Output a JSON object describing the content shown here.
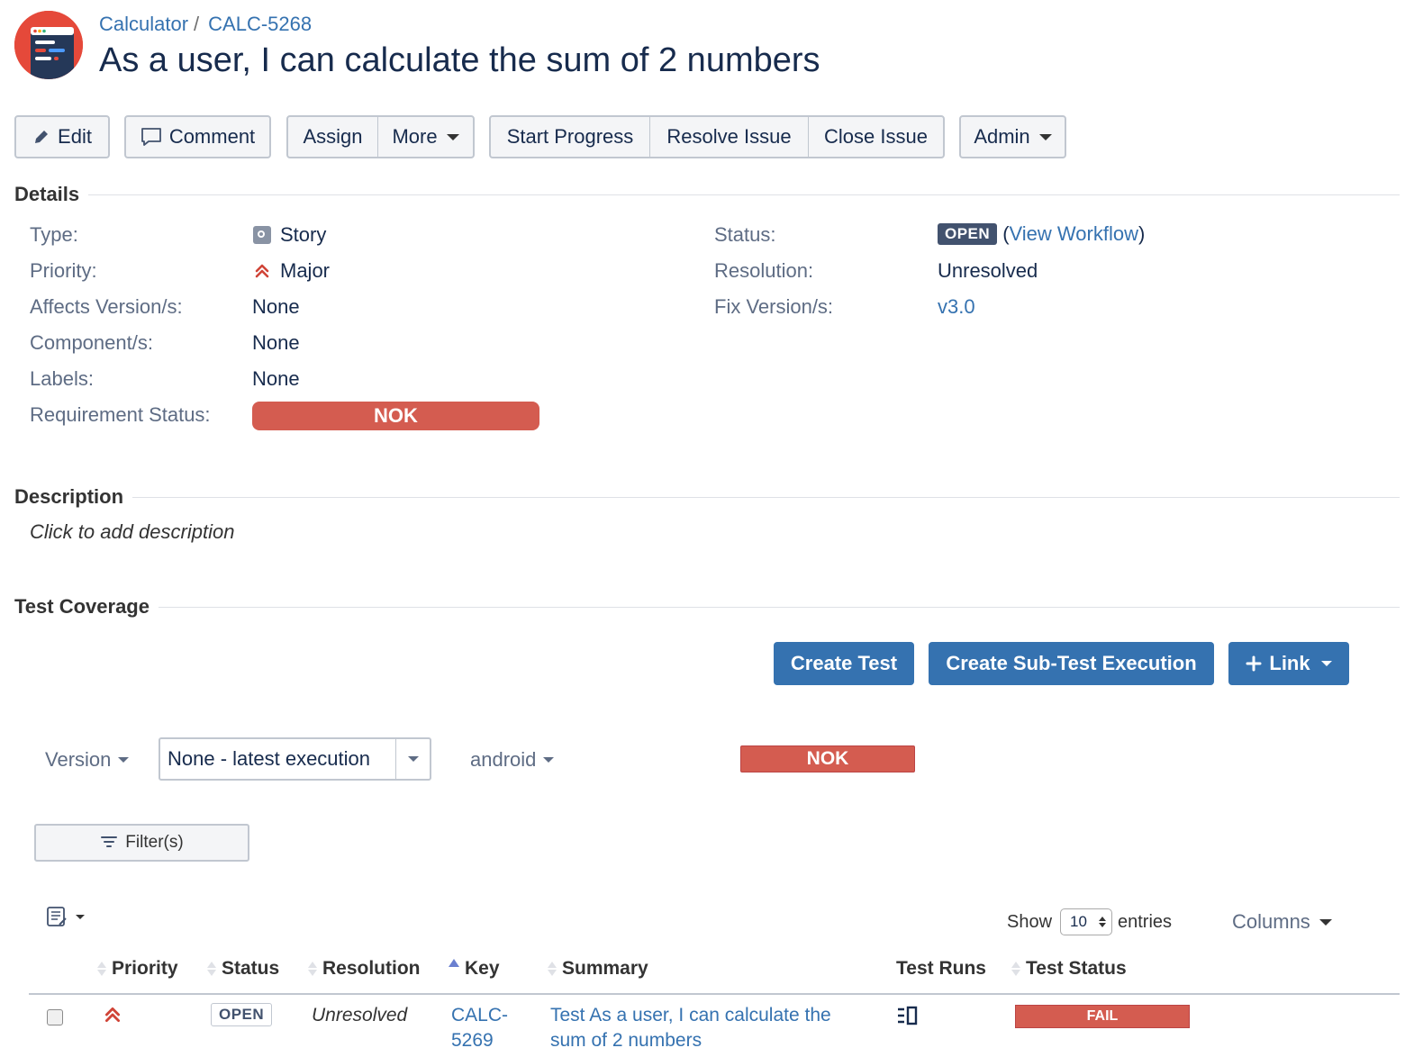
{
  "header": {
    "project": "Calculator",
    "separator": "/",
    "issue_key": "CALC-5268",
    "title": "As a user, I can calculate the sum of 2 numbers"
  },
  "toolbar": {
    "edit": "Edit",
    "comment": "Comment",
    "assign": "Assign",
    "more": "More",
    "start_progress": "Start Progress",
    "resolve_issue": "Resolve Issue",
    "close_issue": "Close Issue",
    "admin": "Admin"
  },
  "details": {
    "heading": "Details",
    "type_label": "Type:",
    "type_value": "Story",
    "priority_label": "Priority:",
    "priority_value": "Major",
    "affects_label": "Affects Version/s:",
    "affects_value": "None",
    "components_label": "Component/s:",
    "components_value": "None",
    "labels_label": "Labels:",
    "labels_value": "None",
    "req_status_label": "Requirement Status:",
    "req_status_value": "NOK",
    "status_label": "Status:",
    "status_value": "OPEN",
    "view_workflow_open": "(",
    "view_workflow": "View Workflow",
    "view_workflow_close": ")",
    "resolution_label": "Resolution:",
    "resolution_value": "Unresolved",
    "fix_label": "Fix Version/s:",
    "fix_value": "v3.0"
  },
  "description": {
    "heading": "Description",
    "placeholder": "Click to add description"
  },
  "test_coverage": {
    "heading": "Test Coverage",
    "create_test": "Create Test",
    "create_sub_test_execution": "Create Sub-Test Execution",
    "link": "Link",
    "version_label": "Version",
    "version_select": "None - latest execution",
    "environment": "android",
    "overall_status": "NOK",
    "filters": "Filter(s)",
    "show": "Show",
    "entries_value": "10",
    "entries": "entries",
    "columns": "Columns",
    "table": {
      "headers": [
        "Priority",
        "Status",
        "Resolution",
        "Key",
        "Summary",
        "Test Runs",
        "Test Status"
      ],
      "rows": [
        {
          "status": "OPEN",
          "resolution": "Unresolved",
          "key_line1": "CALC-",
          "key_line2": "5269",
          "summary_line1": "Test As a user, I can calculate the",
          "summary_line2": "sum of 2 numbers",
          "test_status": "FAIL"
        }
      ]
    }
  },
  "colors": {
    "link": "#3572b0",
    "nok": "#d45c50",
    "primary_button": "#3572b0",
    "open_lozenge": "#42526e",
    "priority_major": "#d04437"
  },
  "icons": {
    "edit": "pencil-icon",
    "comment": "speech-bubble-icon",
    "type": "story-icon",
    "priority": "major-priority-icon",
    "link": "plus-icon",
    "filter": "filter-icon",
    "table_menu": "column-list-icon",
    "test_runs": "test-runs-icon"
  }
}
